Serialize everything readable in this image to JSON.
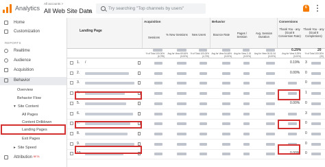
{
  "topbar": {
    "app_title": "Analytics",
    "account_small": "All accounts > ",
    "account_main": "All Web Site Data",
    "search_placeholder": "Try searching \"Top channels by users\"",
    "notification_count": "6",
    "icons": [
      "analytics-logo-icon",
      "search-icon",
      "bell-icon",
      "more-vert-icon"
    ],
    "accent": "#f57c00"
  },
  "sidebar": {
    "items": [
      {
        "label": "Home",
        "icon": "home-icon"
      },
      {
        "label": "Customization",
        "icon": "grid-icon"
      }
    ],
    "reports_header": "REPORTS",
    "report_items": [
      {
        "label": "Realtime",
        "icon": "clock-icon"
      },
      {
        "label": "Audience",
        "icon": "person-icon"
      },
      {
        "label": "Acquisition",
        "icon": "acquisition-icon"
      },
      {
        "label": "Behavior",
        "icon": "behavior-icon"
      }
    ],
    "behavior_sub": [
      "Overview",
      "Behavior Flow",
      "Site Content"
    ],
    "site_content_sub": [
      "All Pages",
      "Content Drilldown",
      "Landing Pages",
      "Exit Pages"
    ],
    "site_speed": "Site Speed",
    "attribution": "Attribution",
    "attribution_badge": "BETA",
    "highlight_color": "#d32f2f"
  },
  "table": {
    "groups": {
      "acquisition": "Acquisition",
      "behavior": "Behavior",
      "conversions": "Conversions"
    },
    "columns": {
      "landing_page": "Landing Page",
      "sessions": "Sessions",
      "new_sessions": "% New Sessions",
      "new_users": "New Users",
      "bounce_rate": "Bounce Rate",
      "pages_session": "Pages / Session",
      "avg_duration": "Avg. Session Duration",
      "goal_conv_rate": "Thank You - any (Goal 8 Conversion Rate)",
      "goal_completions": "Thank You - any (Goal 8 Completions)",
      "goal_header": "Goal 8: Thank You - any"
    },
    "totals_sub": {
      "sessions": "% of Total 100.00% (6,795)",
      "new_sessions": "Avg for View 69.54% (0.00%)",
      "new_users": "% of Total 100.00% (4,725)",
      "bounce_rate": "Avg for View 54.48% (0.00%)",
      "pages_session": "Avg for View 2.15 (0.00%)",
      "avg_duration": "Avg for View 00:01:34 (0.00%)",
      "goal_conv_rate": "Avg for View 0.29% (0.00%)",
      "goal_completions": "% of Total 100.00% (20)"
    },
    "totals": {
      "goal_conv_rate": "0.29%",
      "goal_completions": "20"
    },
    "rows": [
      {
        "num": "1.",
        "page": "/",
        "conv_rate": "0.19%",
        "completions": "3"
      },
      {
        "num": "2.",
        "page": "",
        "conv_rate": "0.00%",
        "completions": "0"
      },
      {
        "num": "3.",
        "page": "",
        "conv_rate": "",
        "completions": "0"
      },
      {
        "num": "4.",
        "page": "",
        "conv_rate": "",
        "completions": "1"
      },
      {
        "num": "5.",
        "page": "",
        "conv_rate": "0.00%",
        "completions": "0"
      },
      {
        "num": "6.",
        "page": "",
        "conv_rate": "",
        "completions": "3"
      },
      {
        "num": "7.",
        "page": "",
        "conv_rate": "",
        "completions": "0"
      },
      {
        "num": "8.",
        "page": "",
        "conv_rate": "",
        "completions": "0"
      },
      {
        "num": "9.",
        "page": "",
        "conv_rate": "",
        "completions": "0"
      },
      {
        "num": "10.",
        "page": "",
        "conv_rate": "0.00%",
        "completions": "0"
      }
    ]
  }
}
